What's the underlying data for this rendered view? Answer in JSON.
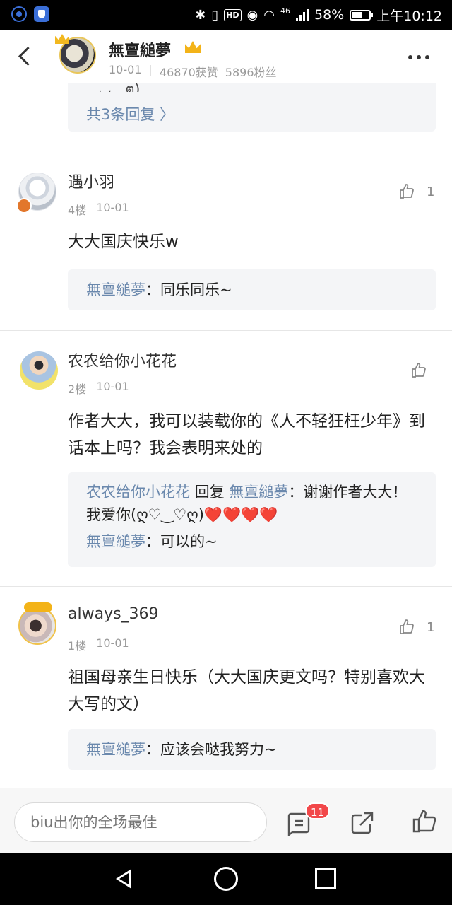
{
  "status_bar": {
    "network": "46",
    "battery": "58%",
    "battery_level": 0.58,
    "time": "上午10:12",
    "hd": "HD"
  },
  "header": {
    "author_name": "無亶縋夢",
    "date": "10-01",
    "likes": "46870获赞",
    "fans": "5896粉丝"
  },
  "top_thread": {
    "partial_text": "◡　ต)",
    "more_replies": "共3条回复 〉"
  },
  "comments": [
    {
      "username": "遇小羽",
      "floor": "4楼",
      "date": "10-01",
      "like_count": "1",
      "text": "大大国庆快乐w",
      "replies": [
        {
          "from": "無亶縋夢",
          "to": "",
          "text": "：同乐同乐~"
        }
      ]
    },
    {
      "username": "农农给你小花花",
      "floor": "2楼",
      "date": "10-01",
      "like_count": "",
      "text": "作者大大，我可以装载你的《人不轻狂枉少年》到话本上吗？我会表明来处的",
      "replies": [
        {
          "from": "农农给你小花花",
          "verb": "回复",
          "to": "無亶縋夢",
          "text": "：谢谢作者大大！我爱你(ღ♡‿♡ღ)❤️❤️❤️❤️"
        },
        {
          "from": "無亶縋夢",
          "to": "",
          "text": "：可以的~"
        }
      ]
    },
    {
      "username": "always_369",
      "floor": "1楼",
      "date": "10-01",
      "like_count": "1",
      "text": "祖国母亲生日快乐（大大国庆更文吗？特别喜欢大大写的文）",
      "replies": [
        {
          "from": "無亶縋夢",
          "to": "",
          "text": "：应该会哒我努力~"
        }
      ]
    }
  ],
  "bottom_bar": {
    "input_placeholder": "biu出你的全场最佳",
    "comment_badge": "11"
  },
  "colors": {
    "link": "#6a88ad",
    "badge": "#f2484a",
    "crown": "#f3b318"
  }
}
